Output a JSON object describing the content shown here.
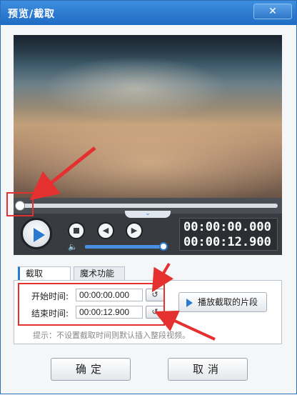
{
  "window": {
    "title": "预览/截取",
    "close_glyph": "✕"
  },
  "player": {
    "time_current": "00:00:00.000",
    "time_total": "00:00:12.900",
    "progress_fraction": 0.0,
    "volume_fraction": 1.0,
    "expand_glyph": "⌄",
    "prev_glyph": "◀",
    "next_glyph": "▶",
    "volume_glyph": "🔈"
  },
  "tabs": [
    {
      "label": "截取",
      "active": true
    },
    {
      "label": "魔术功能",
      "active": false
    }
  ],
  "trim": {
    "start_label": "开始时间:",
    "start_value": "00:00:00.000",
    "end_label": "结束时间:",
    "end_value": "00:00:12.900",
    "reset_glyph": "↺",
    "play_clip_label": "播放截取的片段",
    "hint": "提示：不设置截取时间则默认插入整段视频。"
  },
  "footer": {
    "ok_label": "确定",
    "cancel_label": "取消"
  },
  "colors": {
    "accent": "#2a7ad0",
    "annotation": "#e53030"
  }
}
